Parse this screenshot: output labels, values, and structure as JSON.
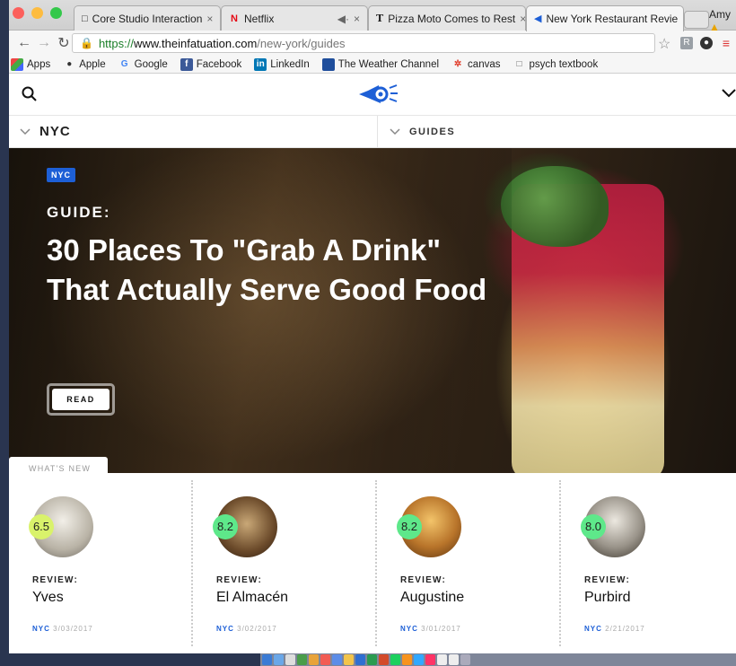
{
  "browser": {
    "tabs": [
      {
        "title": "Core Studio Interaction",
        "favicon": "document-icon"
      },
      {
        "title": "Netflix",
        "favicon": "netflix-icon"
      },
      {
        "title": "Pizza Moto Comes to Rest",
        "favicon": "nyt-icon"
      },
      {
        "title": "New York Restaurant Revie",
        "favicon": "infatuation-icon"
      }
    ],
    "profile_name": "Amy",
    "url_scheme": "https://",
    "url_host": "www.theinfatuation.com",
    "url_path": "/new-york/guides",
    "bookmarks": [
      {
        "label": "Apps",
        "icon": "apps-grid-icon"
      },
      {
        "label": "Apple",
        "icon": "apple-icon"
      },
      {
        "label": "Google",
        "icon": "google-icon"
      },
      {
        "label": "Facebook",
        "icon": "facebook-icon"
      },
      {
        "label": "LinkedIn",
        "icon": "linkedin-icon"
      },
      {
        "label": "The Weather Channel",
        "icon": "weather-channel-icon"
      },
      {
        "label": "canvas",
        "icon": "canvas-icon"
      },
      {
        "label": "psych textbook",
        "icon": "document-icon"
      }
    ]
  },
  "site": {
    "city_selector": "NYC",
    "section_selector": "GUIDES",
    "hero": {
      "badge": "NYC",
      "label": "GUIDE:",
      "headline": "30 Places To \"Grab A Drink\" That Actually Serve Good Food",
      "cta": "READ"
    },
    "whats_new_label": "WHAT'S NEW",
    "reviews": [
      {
        "type": "REVIEW:",
        "name": "Yves",
        "rating": "6.5",
        "city": "NYC",
        "date": "3/03/2017",
        "rating_color": "#d9f26b"
      },
      {
        "type": "REVIEW:",
        "name": "El Almacén",
        "rating": "8.2",
        "city": "NYC",
        "date": "3/02/2017",
        "rating_color": "#5ee88a"
      },
      {
        "type": "REVIEW:",
        "name": "Augustine",
        "rating": "8.2",
        "city": "NYC",
        "date": "3/01/2017",
        "rating_color": "#5ee88a"
      },
      {
        "type": "REVIEW:",
        "name": "Purbird",
        "rating": "8.0",
        "city": "NYC",
        "date": "2/21/2017",
        "rating_color": "#5ee88a"
      }
    ]
  },
  "colors": {
    "accent_blue": "#1d5fd6",
    "secure_green": "#1a7f28"
  }
}
